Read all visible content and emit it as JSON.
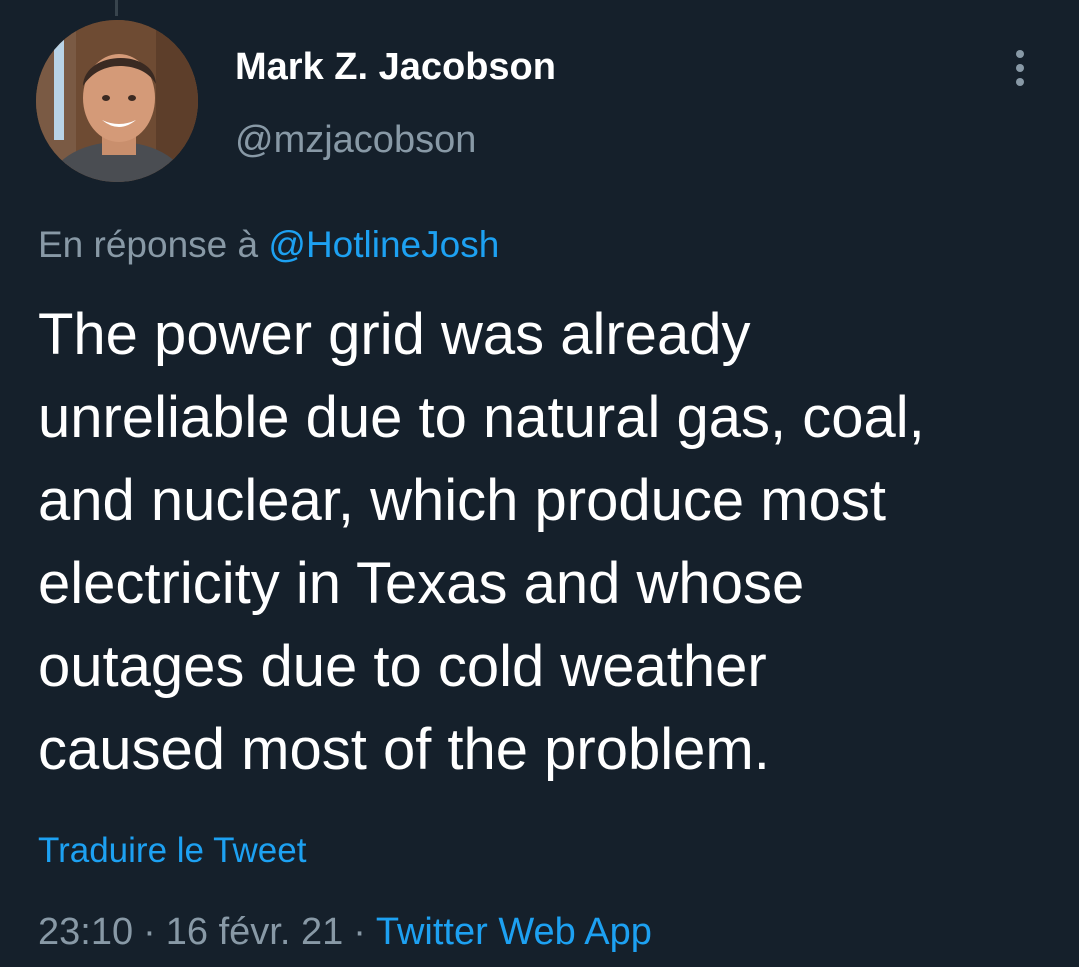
{
  "tweet": {
    "author": {
      "name": "Mark Z. Jacobson",
      "handle": "@mzjacobson"
    },
    "reply_context": {
      "prefix": "En réponse à",
      "mention": "@HotlineJosh"
    },
    "text": "The power grid was already\nunreliable due to natural gas, coal,\nand nuclear, which produce most\nelectricity in Texas and whose\noutages due to cold weather\ncaused most of the problem.",
    "translate_label": "Traduire le Tweet",
    "meta": {
      "time": "23:10",
      "separator": "·",
      "date": "16 févr. 21",
      "source": "Twitter Web App"
    }
  },
  "icons": {
    "more": "more-vertical-icon"
  },
  "colors": {
    "background": "#15202b",
    "primary_text": "#ffffff",
    "secondary_text": "#8899a6",
    "accent": "#1da1f2"
  }
}
